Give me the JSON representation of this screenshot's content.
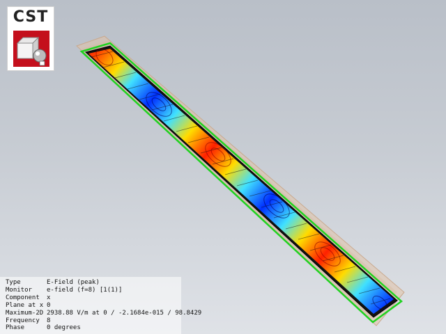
{
  "logo": {
    "text": "CST"
  },
  "info_panel": {
    "rows": [
      {
        "label": "Type",
        "value": "E-Field (peak)"
      },
      {
        "label": "Monitor",
        "value": "e-field (f=8) [1(1)]"
      },
      {
        "label": "Component",
        "value": "x"
      },
      {
        "label": "Plane at x",
        "value": "0"
      },
      {
        "label": "Maximum-2D",
        "value": "2938.88 V/m at 0 / -2.1684e-015 / 98.8429"
      },
      {
        "label": "Frequency",
        "value": "8"
      },
      {
        "label": "Phase",
        "value": "0 degrees"
      }
    ]
  },
  "colors": {
    "field_max": "#ff2000",
    "field_min": "#0030ff",
    "boundary": "#1fd21f",
    "substrate": "#e2c3a8"
  },
  "field_pattern": {
    "half_wavelength_lobes": [
      "positive",
      "negative",
      "positive",
      "negative",
      "positive",
      "negative"
    ]
  }
}
